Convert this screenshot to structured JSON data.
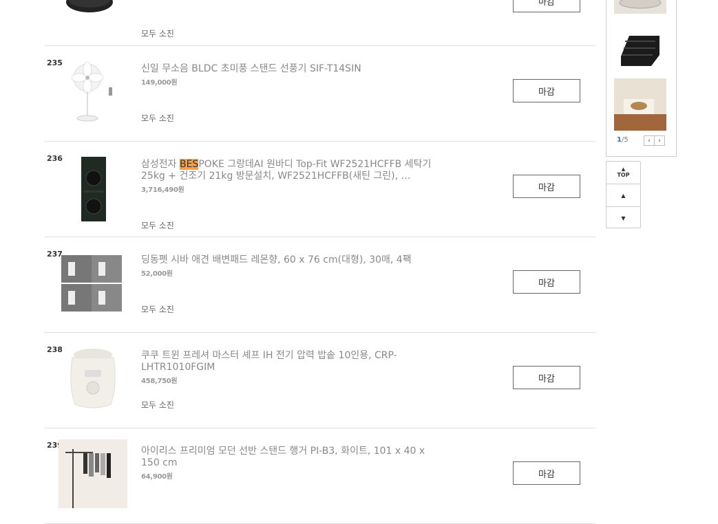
{
  "products": [
    {
      "rank": "",
      "title": "",
      "price": "",
      "soldout": "모두 소진",
      "button": ""
    },
    {
      "rank": "235",
      "title": "신일 무소음 BLDC 초미풍 스탠드 선풍기 SIF-T14SIN",
      "price": "149,000원",
      "soldout": "모두 소진",
      "button": "마감"
    },
    {
      "rank": "236",
      "title_hl": "BES",
      "title_pre": "삼성전자 ",
      "title_post": "POKE 그랑데AI 원바디 Top-Fit WF2521HCFFB 세탁기 25kg + 건조기 21kg 방문설치, WF2521HCFFB(새틴 그린), …",
      "price": "3,716,490원",
      "soldout": "모두 소진",
      "button": "마감"
    },
    {
      "rank": "237",
      "title": "딩동펫 시바 애견 배변패드 레몬향, 60 x 76 cm(대형), 30매, 4팩",
      "price": "52,000원",
      "soldout": "모두 소진",
      "button": "마감"
    },
    {
      "rank": "238",
      "title": "쿠쿠 트윈 프레셔 마스터 셰프 IH 전기 압력 밥솥 10인용, CRP-LHTR1010FGIM",
      "price": "458,750원",
      "soldout": "모두 소진",
      "button": "마감"
    },
    {
      "rank": "239",
      "title": "아이리스 프리미엄 모던 선반 스탠드 행거 PI-B3, 화이트, 101 x 40 x 150 cm",
      "price": "64,900원",
      "soldout": "",
      "button": "마감"
    }
  ],
  "side": {
    "page_current": "1",
    "page_total": "/5",
    "prev": "‹",
    "next": "›"
  },
  "nav": {
    "top": "TOP"
  }
}
